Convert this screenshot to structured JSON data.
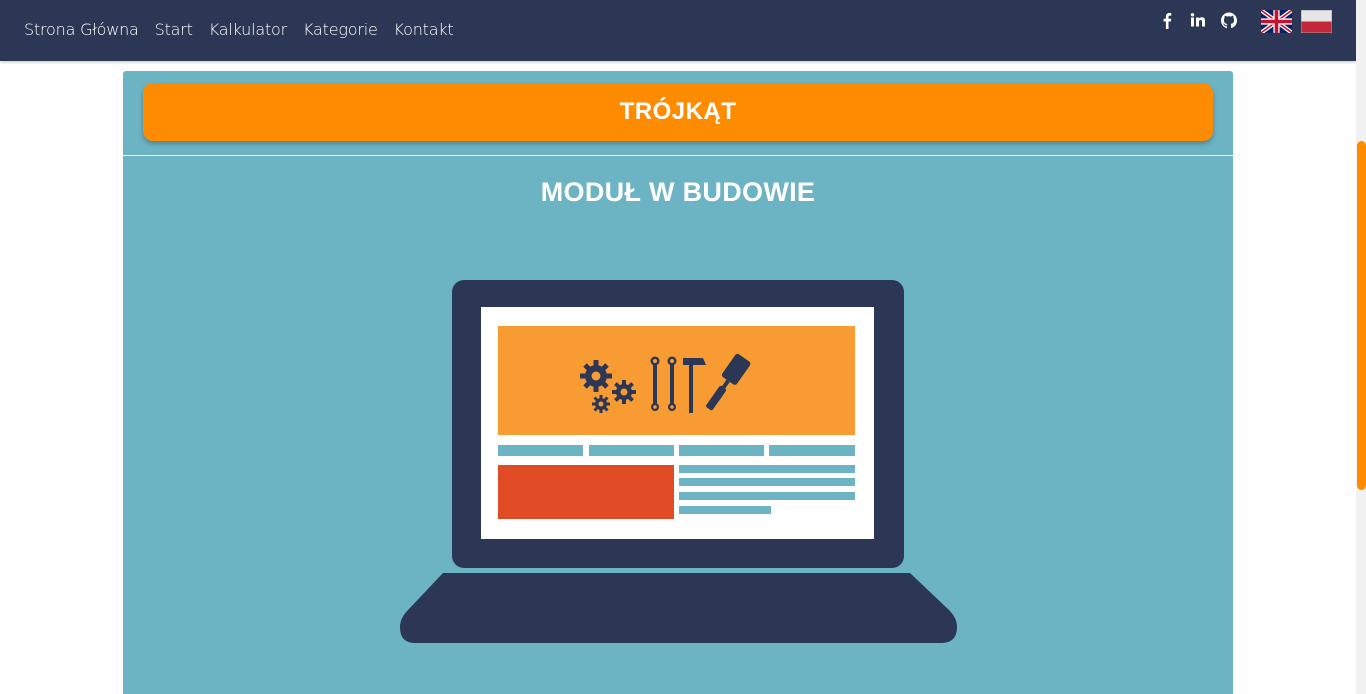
{
  "nav": {
    "links": [
      "Strona Główna",
      "Start",
      "Kalkulator",
      "Kategorie",
      "Kontakt"
    ],
    "social_icons": [
      "facebook-icon",
      "linkedin-icon",
      "github-icon"
    ],
    "languages": [
      "English",
      "Polski"
    ]
  },
  "main": {
    "title": "TRÓJKĄT",
    "subtitle": "MODUŁ W BUDOWIE",
    "illustration": "laptop-under-construction-illustration"
  },
  "colors": {
    "nav_bg": "#2c3755",
    "panel_bg": "#6cb3c3",
    "accent": "#ff8c00",
    "banner_orange": "#f89b33",
    "block_red": "#e04b25",
    "line_blue": "#6cb3c3"
  }
}
